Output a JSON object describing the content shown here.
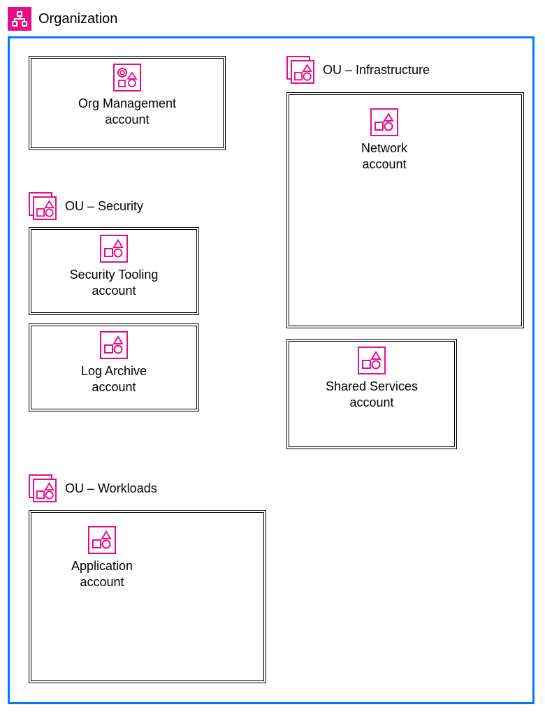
{
  "colors": {
    "accent": "#e60e85",
    "frame": "#007aff"
  },
  "organization": {
    "title": "Organization"
  },
  "org_management": {
    "label": "Org Management\naccount"
  },
  "ou_security": {
    "title": "OU – Security",
    "accounts": {
      "security_tooling": "Security Tooling\naccount",
      "log_archive": "Log Archive\naccount"
    }
  },
  "ou_workloads": {
    "title": "OU – Workloads",
    "accounts": {
      "application": "Application\naccount"
    }
  },
  "ou_infrastructure": {
    "title": "OU – Infrastructure",
    "accounts": {
      "network": "Network\naccount",
      "shared_services": "Shared Services\naccount"
    }
  }
}
